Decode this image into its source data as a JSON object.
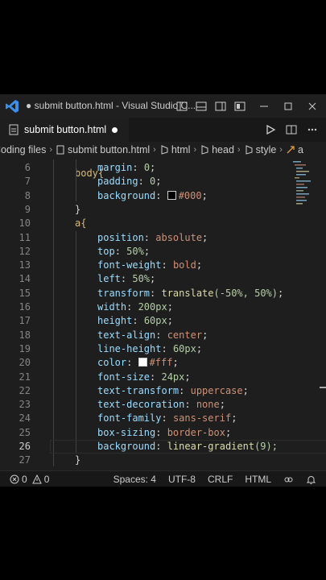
{
  "window": {
    "title": "● submit button.html - Visual Studio C...",
    "accent": "#3b8eea"
  },
  "tab": {
    "filename": "submit button.html"
  },
  "breadcrumb": {
    "items": [
      "Coding files",
      "submit button.html",
      "html",
      "head",
      "style",
      "a"
    ]
  },
  "editor": {
    "current_line": "26",
    "partial_top_line": "body{",
    "lines": [
      {
        "n": "6",
        "kind": "decl",
        "prop": "margin",
        "val": "0",
        "vtype": "num"
      },
      {
        "n": "7",
        "kind": "decl",
        "prop": "padding",
        "val": "0",
        "vtype": "num"
      },
      {
        "n": "8",
        "kind": "decl",
        "prop": "background",
        "val": "#000",
        "vtype": "color",
        "swatch": "#000000"
      },
      {
        "n": "9",
        "kind": "close",
        "text": "}"
      },
      {
        "n": "10",
        "kind": "sel",
        "text": "a{"
      },
      {
        "n": "11",
        "kind": "decl",
        "prop": "position",
        "val": "absolute",
        "vtype": "str"
      },
      {
        "n": "12",
        "kind": "decl",
        "prop": "top",
        "val": "50%",
        "vtype": "num"
      },
      {
        "n": "13",
        "kind": "decl",
        "prop": "font-weight",
        "val": "bold",
        "vtype": "str"
      },
      {
        "n": "14",
        "kind": "decl",
        "prop": "left",
        "val": "50%",
        "vtype": "num"
      },
      {
        "n": "15",
        "kind": "decl",
        "prop": "transform",
        "val": "translate(-50%, 50%)",
        "vtype": "fn"
      },
      {
        "n": "16",
        "kind": "decl",
        "prop": "width",
        "val": "200px",
        "vtype": "num"
      },
      {
        "n": "17",
        "kind": "decl",
        "prop": "height",
        "val": "60px",
        "vtype": "num"
      },
      {
        "n": "18",
        "kind": "decl",
        "prop": "text-align",
        "val": "center",
        "vtype": "str"
      },
      {
        "n": "19",
        "kind": "decl",
        "prop": "line-height",
        "val": "60px",
        "vtype": "num"
      },
      {
        "n": "20",
        "kind": "decl",
        "prop": "color",
        "val": "#fff",
        "vtype": "color",
        "swatch": "#ffffff"
      },
      {
        "n": "21",
        "kind": "decl",
        "prop": "font-size",
        "val": "24px",
        "vtype": "num"
      },
      {
        "n": "22",
        "kind": "decl",
        "prop": "text-transform",
        "val": "uppercase",
        "vtype": "str"
      },
      {
        "n": "23",
        "kind": "decl",
        "prop": "text-decoration",
        "val": "none",
        "vtype": "str"
      },
      {
        "n": "24",
        "kind": "decl",
        "prop": "font-family",
        "val": "sans-serif",
        "vtype": "str"
      },
      {
        "n": "25",
        "kind": "decl",
        "prop": "box-sizing",
        "val": "border-box",
        "vtype": "str"
      },
      {
        "n": "26",
        "kind": "decl",
        "prop": "background",
        "val": "linear-gradient(9);",
        "vtype": "fn"
      },
      {
        "n": "27",
        "kind": "close",
        "text": "}"
      }
    ]
  },
  "status": {
    "errors": "0",
    "warnings": "0",
    "spaces": "Spaces: 4",
    "encoding": "UTF-8",
    "eol": "CRLF",
    "language": "HTML"
  }
}
